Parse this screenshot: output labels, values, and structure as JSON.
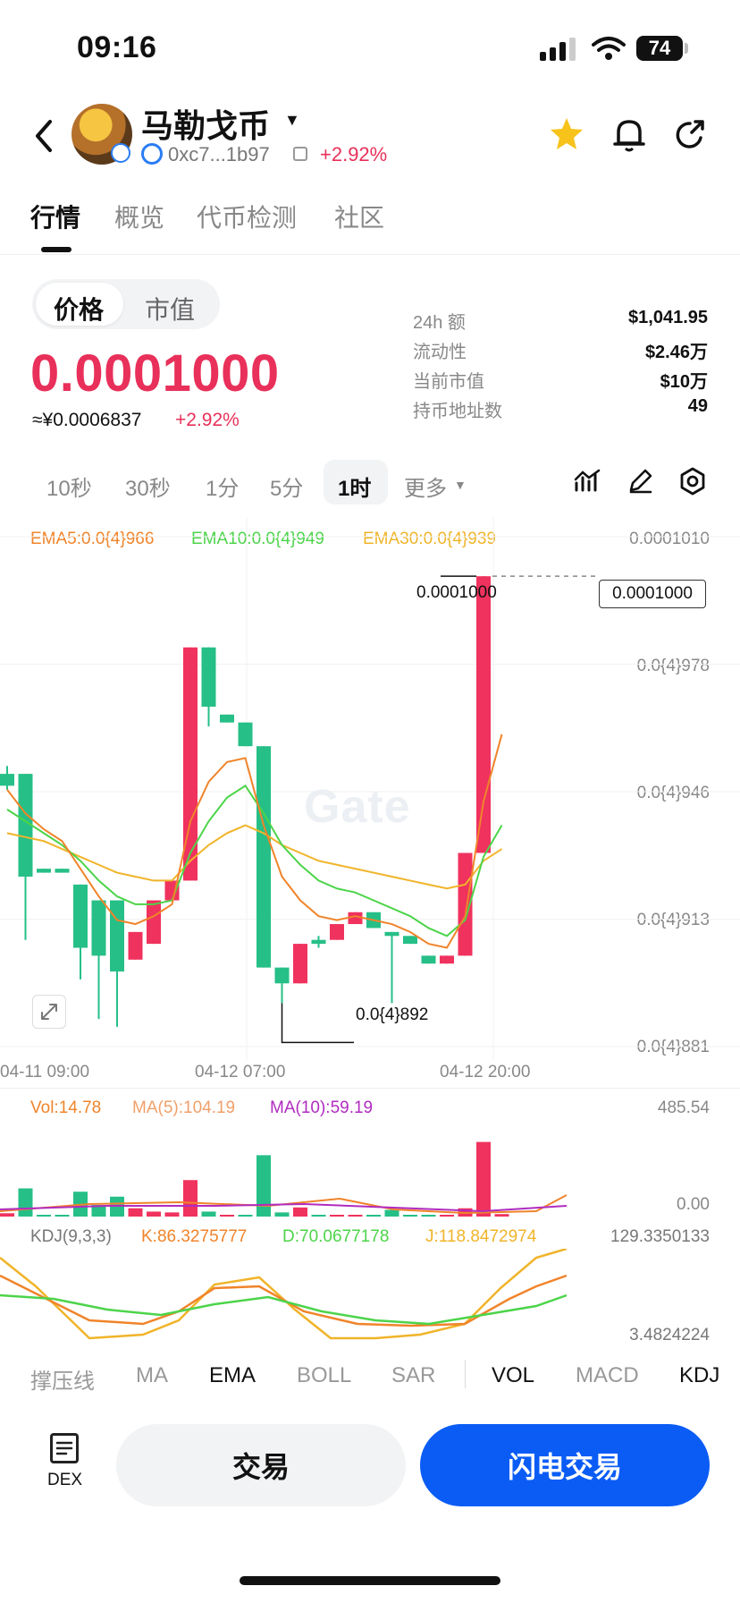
{
  "status_bar": {
    "time": "09:16",
    "battery": "74"
  },
  "header": {
    "token_name": "马勒戈币",
    "address": "0xc7...1b97",
    "change": "+2.92%"
  },
  "tabs": [
    {
      "label": "行情",
      "active": true
    },
    {
      "label": "概览",
      "active": false
    },
    {
      "label": "代币检测",
      "active": false
    },
    {
      "label": "社区",
      "active": false
    }
  ],
  "price_toggle": {
    "price": "价格",
    "mcap": "市值",
    "selected": "价格"
  },
  "price": {
    "value": "0.0001000",
    "cny": "≈¥0.0006837",
    "change": "+2.92%"
  },
  "stats": [
    {
      "label": "24h 额",
      "value": "$1,041.95"
    },
    {
      "label": "流动性",
      "value": "$2.46万"
    },
    {
      "label": "当前市值",
      "value": "$10万"
    },
    {
      "label": "持币地址数",
      "value": "49"
    }
  ],
  "timeframes": [
    "10秒",
    "30秒",
    "1分",
    "5分",
    "1时"
  ],
  "timeframe_selected": "1时",
  "more_label": "更多",
  "ema_legend": {
    "ema5": "EMA5:0.0{4}966",
    "ema10": "EMA10:0.0{4}949",
    "ema30": "EMA30:0.0{4}939"
  },
  "colors": {
    "up": "#f0325e",
    "down": "#26bf87",
    "accent": "#0a5cf5",
    "ema5": "#f0842a",
    "ema10": "#4cd44a",
    "ema30": "#f0b429",
    "ma10": "#b02cc0"
  },
  "watermark": "Gate",
  "chart_data": {
    "type": "candlestick",
    "y_ticks": [
      "0.0001010",
      "0.0{4}978",
      "0.0{4}946",
      "0.0{4}913",
      "0.0{4}881"
    ],
    "x_ticks": [
      "04-11 09:00",
      "04-12 07:00",
      "04-12 20:00"
    ],
    "ylim": [
      8.81e-05,
      0.000101
    ],
    "current_price_label": "0.0001000",
    "high_label": "0.0001000",
    "low_label": "0.0{4}892",
    "candles": [
      {
        "o": 9.5e-05,
        "c": 9.47e-05,
        "h": 9.52e-05,
        "l": 9.46e-05
      },
      {
        "o": 9.5e-05,
        "c": 9.24e-05,
        "h": 9.5e-05,
        "l": 9.08e-05
      },
      {
        "o": 9.26e-05,
        "c": 9.25e-05,
        "h": 9.26e-05,
        "l": 9.25e-05
      },
      {
        "o": 9.26e-05,
        "c": 9.25e-05,
        "h": 9.26e-05,
        "l": 9.25e-05
      },
      {
        "o": 9.22e-05,
        "c": 9.06e-05,
        "h": 9.22e-05,
        "l": 8.98e-05
      },
      {
        "o": 9.18e-05,
        "c": 9.04e-05,
        "h": 9.18e-05,
        "l": 8.88e-05
      },
      {
        "o": 9.18e-05,
        "c": 9e-05,
        "h": 9.18e-05,
        "l": 8.86e-05
      },
      {
        "o": 9.03e-05,
        "c": 9.1e-05,
        "h": 9.1e-05,
        "l": 9.03e-05
      },
      {
        "o": 9.07e-05,
        "c": 9.18e-05,
        "h": 9.18e-05,
        "l": 9.07e-05
      },
      {
        "o": 9.18e-05,
        "c": 9.23e-05,
        "h": 9.23e-05,
        "l": 9.18e-05
      },
      {
        "o": 9.23e-05,
        "c": 9.82e-05,
        "h": 9.82e-05,
        "l": 9.23e-05
      },
      {
        "o": 9.82e-05,
        "c": 9.67e-05,
        "h": 9.82e-05,
        "l": 9.62e-05
      },
      {
        "o": 9.65e-05,
        "c": 9.63e-05,
        "h": 9.65e-05,
        "l": 9.63e-05
      },
      {
        "o": 9.63e-05,
        "c": 9.57e-05,
        "h": 9.63e-05,
        "l": 9.57e-05
      },
      {
        "o": 9.57e-05,
        "c": 9.01e-05,
        "h": 9.57e-05,
        "l": 9.01e-05
      },
      {
        "o": 9.01e-05,
        "c": 8.97e-05,
        "h": 9.01e-05,
        "l": 8.92e-05
      },
      {
        "o": 8.97e-05,
        "c": 9.07e-05,
        "h": 9.07e-05,
        "l": 8.97e-05
      },
      {
        "o": 9.08e-05,
        "c": 9.07e-05,
        "h": 9.09e-05,
        "l": 9.06e-05
      },
      {
        "o": 9.08e-05,
        "c": 9.12e-05,
        "h": 9.12e-05,
        "l": 9.08e-05
      },
      {
        "o": 9.12e-05,
        "c": 9.15e-05,
        "h": 9.15e-05,
        "l": 9.12e-05
      },
      {
        "o": 9.15e-05,
        "c": 9.11e-05,
        "h": 9.15e-05,
        "l": 9.11e-05
      },
      {
        "o": 9.1e-05,
        "c": 9.09e-05,
        "h": 9.1e-05,
        "l": 8.92e-05
      },
      {
        "o": 9.09e-05,
        "c": 9.07e-05,
        "h": 9.09e-05,
        "l": 9.07e-05
      },
      {
        "o": 9.04e-05,
        "c": 9.02e-05,
        "h": 9.04e-05,
        "l": 9.02e-05
      },
      {
        "o": 9.02e-05,
        "c": 9.04e-05,
        "h": 9.04e-05,
        "l": 9.02e-05
      },
      {
        "o": 9.04e-05,
        "c": 9.3e-05,
        "h": 9.3e-05,
        "l": 9.04e-05
      },
      {
        "o": 9.3e-05,
        "c": 0.0001,
        "h": 0.0001,
        "l": 9.3e-05
      }
    ],
    "ema5": [
      9.46e-05,
      9.4e-05,
      9.36e-05,
      9.33e-05,
      9.26e-05,
      9.19e-05,
      9.13e-05,
      9.12e-05,
      9.14e-05,
      9.17e-05,
      9.38e-05,
      9.48e-05,
      9.53e-05,
      9.54e-05,
      9.37e-05,
      9.24e-05,
      9.18e-05,
      9.14e-05,
      9.13e-05,
      9.14e-05,
      9.13e-05,
      9.12e-05,
      9.1e-05,
      9.07e-05,
      9.06e-05,
      9.14e-05,
      9.43e-05,
      9.6e-05
    ],
    "ema10": [
      9.41e-05,
      9.38e-05,
      9.35e-05,
      9.32e-05,
      9.28e-05,
      9.23e-05,
      9.19e-05,
      9.17e-05,
      9.17e-05,
      9.18e-05,
      9.3e-05,
      9.38e-05,
      9.44e-05,
      9.47e-05,
      9.4e-05,
      9.32e-05,
      9.27e-05,
      9.23e-05,
      9.21e-05,
      9.2e-05,
      9.18e-05,
      9.16e-05,
      9.14e-05,
      9.11e-05,
      9.09e-05,
      9.13e-05,
      9.29e-05,
      9.37e-05
    ],
    "ema30": [
      9.35e-05,
      9.34e-05,
      9.33e-05,
      9.31e-05,
      9.29e-05,
      9.27e-05,
      9.25e-05,
      9.24e-05,
      9.23e-05,
      9.23e-05,
      9.28e-05,
      9.32e-05,
      9.35e-05,
      9.37e-05,
      9.35e-05,
      9.32e-05,
      9.3e-05,
      9.28e-05,
      9.27e-05,
      9.26e-05,
      9.25e-05,
      9.24e-05,
      9.23e-05,
      9.22e-05,
      9.21e-05,
      9.22e-05,
      9.28e-05,
      9.31e-05
    ]
  },
  "volume": {
    "legend": {
      "vol": "Vol:14.78",
      "ma5": "MA(5):104.19",
      "ma10": "MA(10):59.19"
    },
    "y_top": "485.54",
    "y_bottom": "0.00",
    "bars": [
      {
        "v": 20,
        "up": true
      },
      {
        "v": 170,
        "up": false
      },
      {
        "v": 10,
        "up": false
      },
      {
        "v": 10,
        "up": false
      },
      {
        "v": 150,
        "up": false
      },
      {
        "v": 70,
        "up": false
      },
      {
        "v": 120,
        "up": false
      },
      {
        "v": 50,
        "up": true
      },
      {
        "v": 30,
        "up": true
      },
      {
        "v": 25,
        "up": true
      },
      {
        "v": 220,
        "up": true
      },
      {
        "v": 30,
        "up": false
      },
      {
        "v": 8,
        "up": true
      },
      {
        "v": 8,
        "up": false
      },
      {
        "v": 370,
        "up": false
      },
      {
        "v": 25,
        "up": false
      },
      {
        "v": 55,
        "up": true
      },
      {
        "v": 8,
        "up": false
      },
      {
        "v": 8,
        "up": true
      },
      {
        "v": 8,
        "up": true
      },
      {
        "v": 10,
        "up": false
      },
      {
        "v": 40,
        "up": false
      },
      {
        "v": 8,
        "up": false
      },
      {
        "v": 8,
        "up": false
      },
      {
        "v": 8,
        "up": true
      },
      {
        "v": 50,
        "up": true
      },
      {
        "v": 450,
        "up": true
      },
      {
        "v": 15,
        "up": true
      }
    ]
  },
  "kdj": {
    "legend": {
      "name": "KDJ(9,3,3)",
      "k": "K:86.3275777",
      "d": "D:70.0677178",
      "j": "J:118.8472974"
    },
    "y_top": "129.3350133",
    "y_bottom": "3.4824224"
  },
  "indicator_tabs": [
    {
      "label": "撑压线",
      "on": false
    },
    {
      "label": "MA",
      "on": false
    },
    {
      "label": "EMA",
      "on": true
    },
    {
      "label": "BOLL",
      "on": false
    },
    {
      "label": "SAR",
      "on": false
    },
    {
      "label": "VOL",
      "on": true
    },
    {
      "label": "MACD",
      "on": false
    },
    {
      "label": "KDJ",
      "on": true
    }
  ],
  "bottom_bar": {
    "dex": "DEX",
    "trade": "交易",
    "flash_trade": "闪电交易"
  }
}
